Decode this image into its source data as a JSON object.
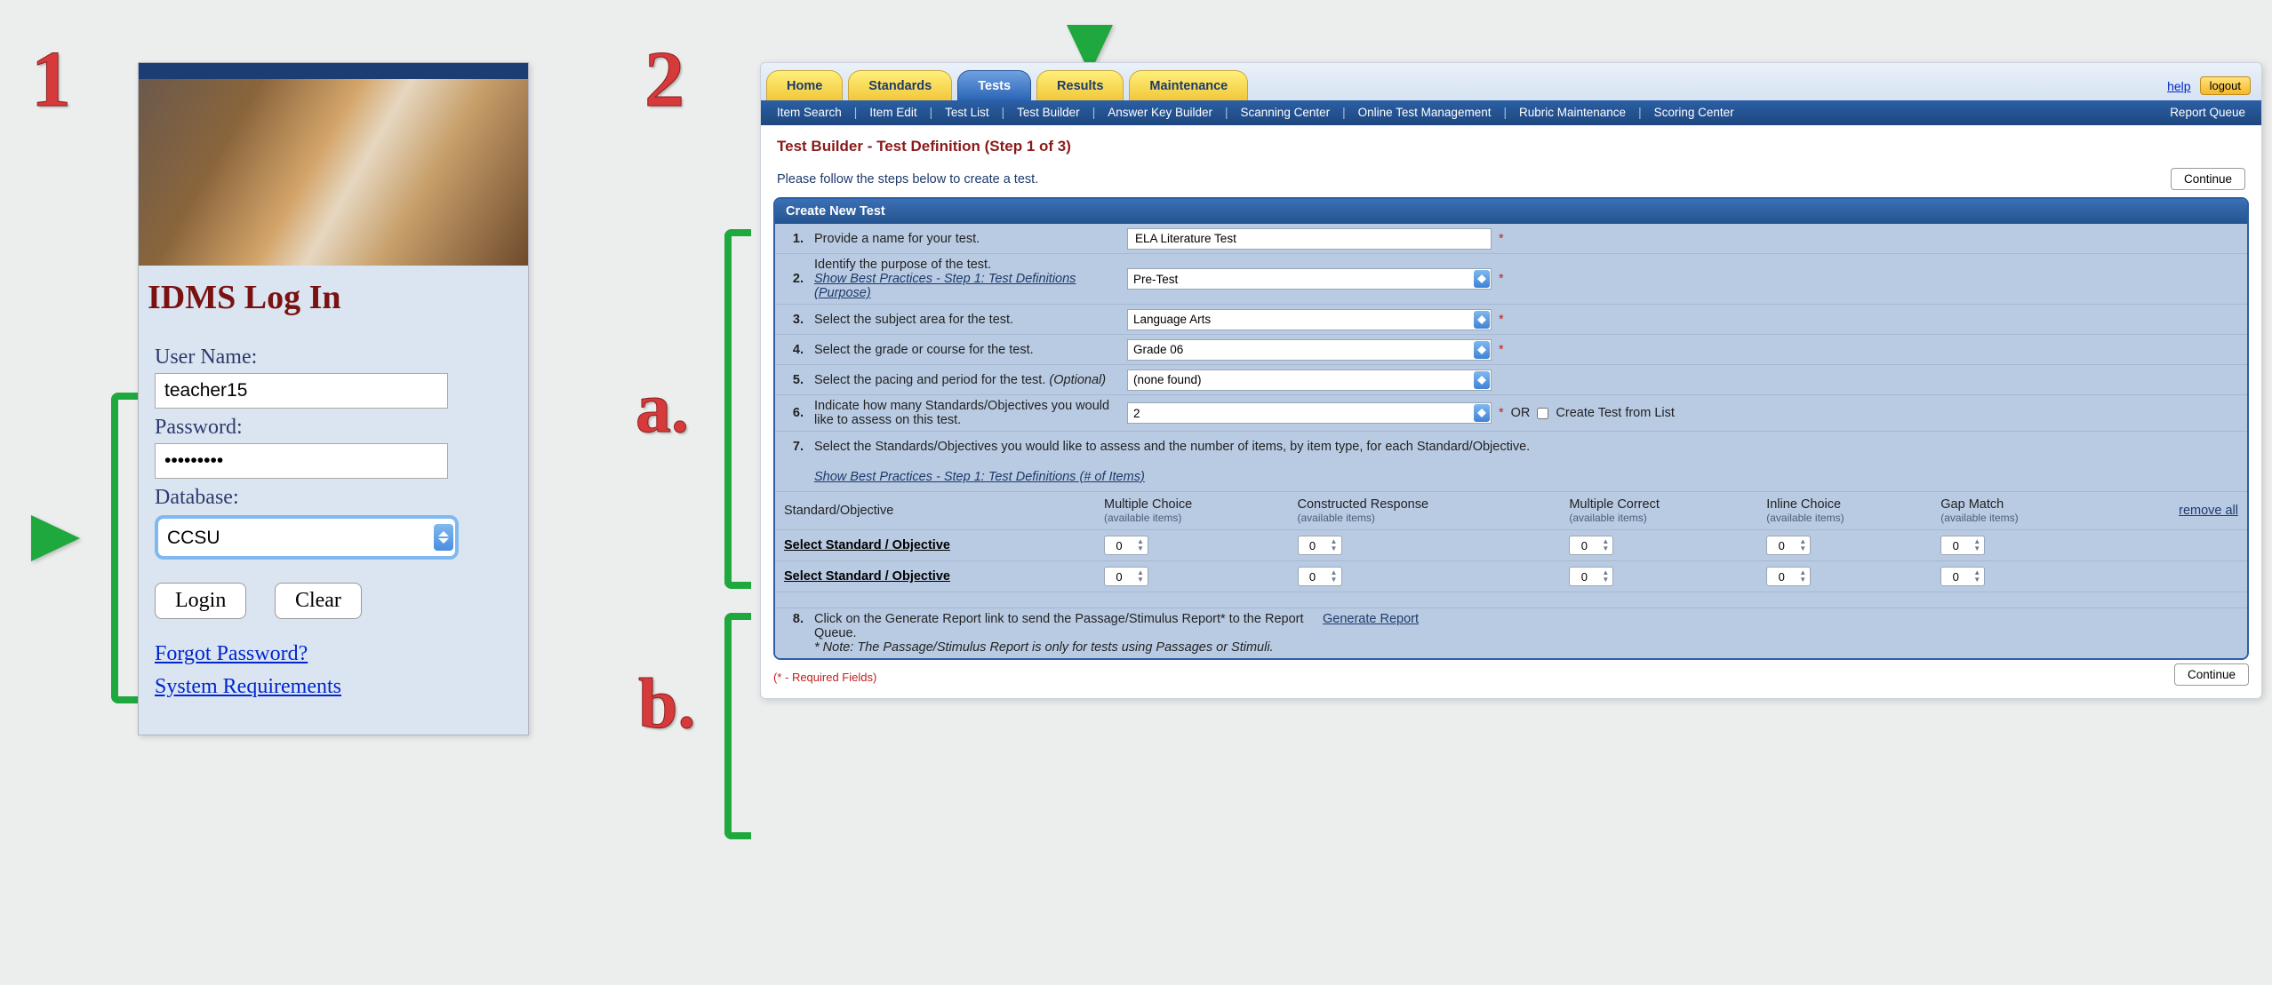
{
  "callouts": {
    "one": "1",
    "two": "2",
    "a": "a.",
    "b": "b."
  },
  "login": {
    "title": "IDMS Log In",
    "user_label": "User Name:",
    "user_value": "teacher15",
    "password_label": "Password:",
    "password_value": "•••••••••",
    "database_label": "Database:",
    "database_value": "CCSU",
    "login_btn": "Login",
    "clear_btn": "Clear",
    "forgot_link": "Forgot Password?",
    "sysreq_link": "System Requirements"
  },
  "app": {
    "tabs": {
      "home": "Home",
      "standards": "Standards",
      "tests": "Tests",
      "results": "Results",
      "maintenance": "Maintenance"
    },
    "top_right": {
      "help": "help",
      "logout": "logout"
    },
    "subnav": {
      "item_search": "Item Search",
      "item_edit": "Item Edit",
      "test_list": "Test List",
      "test_builder": "Test Builder",
      "answer_key_builder": "Answer Key Builder",
      "scanning_center": "Scanning Center",
      "online_test_management": "Online Test Management",
      "rubric_maintenance": "Rubric Maintenance",
      "scoring_center": "Scoring Center",
      "report_queue": "Report Queue"
    },
    "page_title": "Test Builder - Test Definition (Step 1 of 3)",
    "instruction": "Please follow the steps below to create a test.",
    "continue": "Continue",
    "panel_header": "Create New Test",
    "steps": {
      "s1": {
        "n": "1.",
        "lbl": "Provide a name for your test.",
        "val": "ELA Literature Test"
      },
      "s2": {
        "n": "2.",
        "lbl": "Identify the purpose of the test.",
        "link": "Show Best Practices - Step 1: Test Definitions (Purpose)",
        "val": "Pre-Test"
      },
      "s3": {
        "n": "3.",
        "lbl": "Select the subject area for the test.",
        "val": "Language Arts"
      },
      "s4": {
        "n": "4.",
        "lbl": "Select the grade or course for the test.",
        "val": "Grade 06"
      },
      "s5": {
        "n": "5.",
        "lbl_a": "Select the pacing and period for the test.",
        "lbl_b": "(Optional)",
        "val": "(none found)"
      },
      "s6": {
        "n": "6.",
        "lbl": "Indicate how many Standards/Objectives you would like to assess on this test.",
        "val": "2",
        "or": "OR",
        "chk": "Create Test from List"
      },
      "s7": {
        "n": "7.",
        "lbl": "Select the Standards/Objectives you would like to assess and the number of items, by item type, for each Standard/Objective.",
        "link": "Show Best Practices - Step 1: Test Definitions (# of Items)"
      },
      "s8": {
        "n": "8.",
        "lbl_a": "Click on the Generate Report link to send the Passage/Stimulus Report* to the Report Queue.",
        "lbl_b": "* Note: The Passage/Stimulus Report is only for tests using Passages or Stimuli.",
        "gen": "Generate Report"
      }
    },
    "table": {
      "headers": {
        "std": "Standard/Objective",
        "mc": "Multiple Choice",
        "cr": "Constructed Response",
        "mcor": "Multiple Correct",
        "ic": "Inline Choice",
        "gm": "Gap Match",
        "avail": "(available items)",
        "remove": "remove all"
      },
      "rows": [
        {
          "name": "Select Standard / Objective",
          "mc": "0",
          "cr": "0",
          "mcor": "0",
          "ic": "0",
          "gm": "0"
        },
        {
          "name": "Select Standard / Objective",
          "mc": "0",
          "cr": "0",
          "mcor": "0",
          "ic": "0",
          "gm": "0"
        }
      ]
    },
    "required_note": "(* - Required Fields)"
  }
}
